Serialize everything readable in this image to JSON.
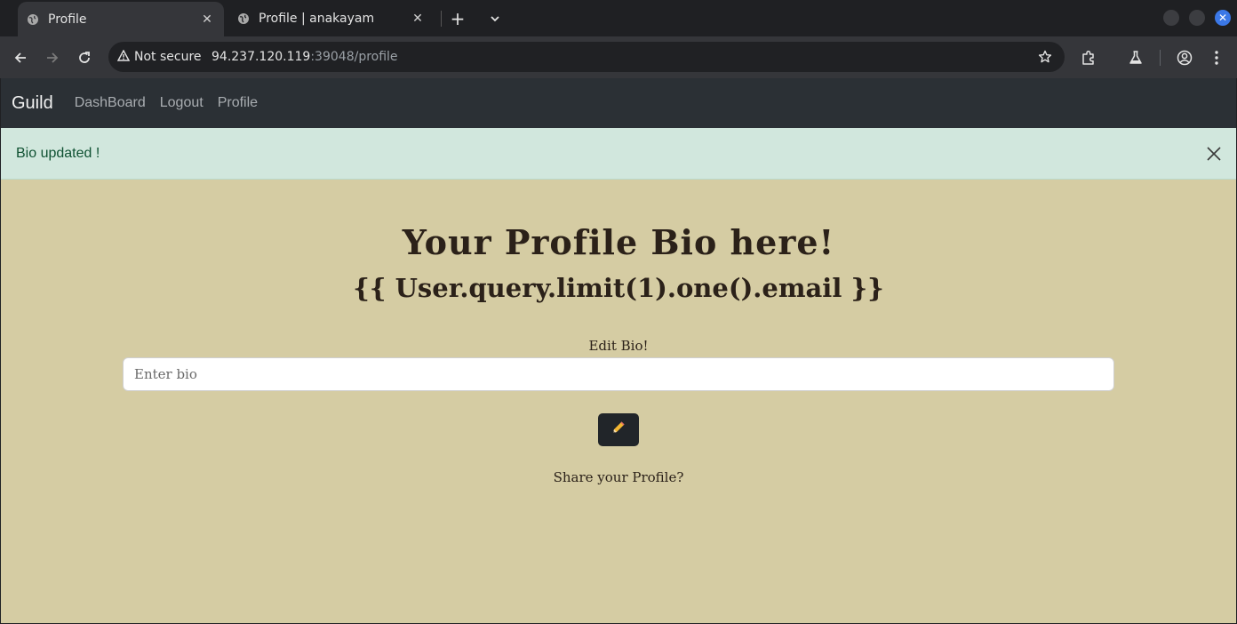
{
  "browser": {
    "tabs": [
      {
        "title": "Profile",
        "close": "✕",
        "active": true
      },
      {
        "title": "Profile | anakayam",
        "close": "✕",
        "active": false
      }
    ],
    "new_tab_glyph": "+",
    "tab_list_icon": "chevron-down-icon",
    "window_close_glyph": "✕",
    "security_label": "Not secure",
    "url_host": "94.237.120.119",
    "url_rest": ":39048/profile",
    "icons": [
      "back-icon",
      "forward-icon",
      "reload-icon",
      "warning-icon",
      "star-icon",
      "extensions-icon",
      "labs-icon",
      "profile-icon",
      "menu-icon"
    ]
  },
  "navbar": {
    "brand": "Guild",
    "links": [
      "DashBoard",
      "Logout",
      "Profile"
    ],
    "background": "#2b3035"
  },
  "alert": {
    "text": "Bio updated !",
    "background": "#d1e7dd",
    "text_color": "#0f5132"
  },
  "main": {
    "heading": "Your Profile Bio here!",
    "bio": "{{ User.query.limit(1).one().email }}",
    "edit_label": "Edit Bio!",
    "input_placeholder": "Enter bio",
    "submit_icon": "pencil-icon",
    "share_text": "Share your Profile?",
    "background": "#d5cca3"
  }
}
